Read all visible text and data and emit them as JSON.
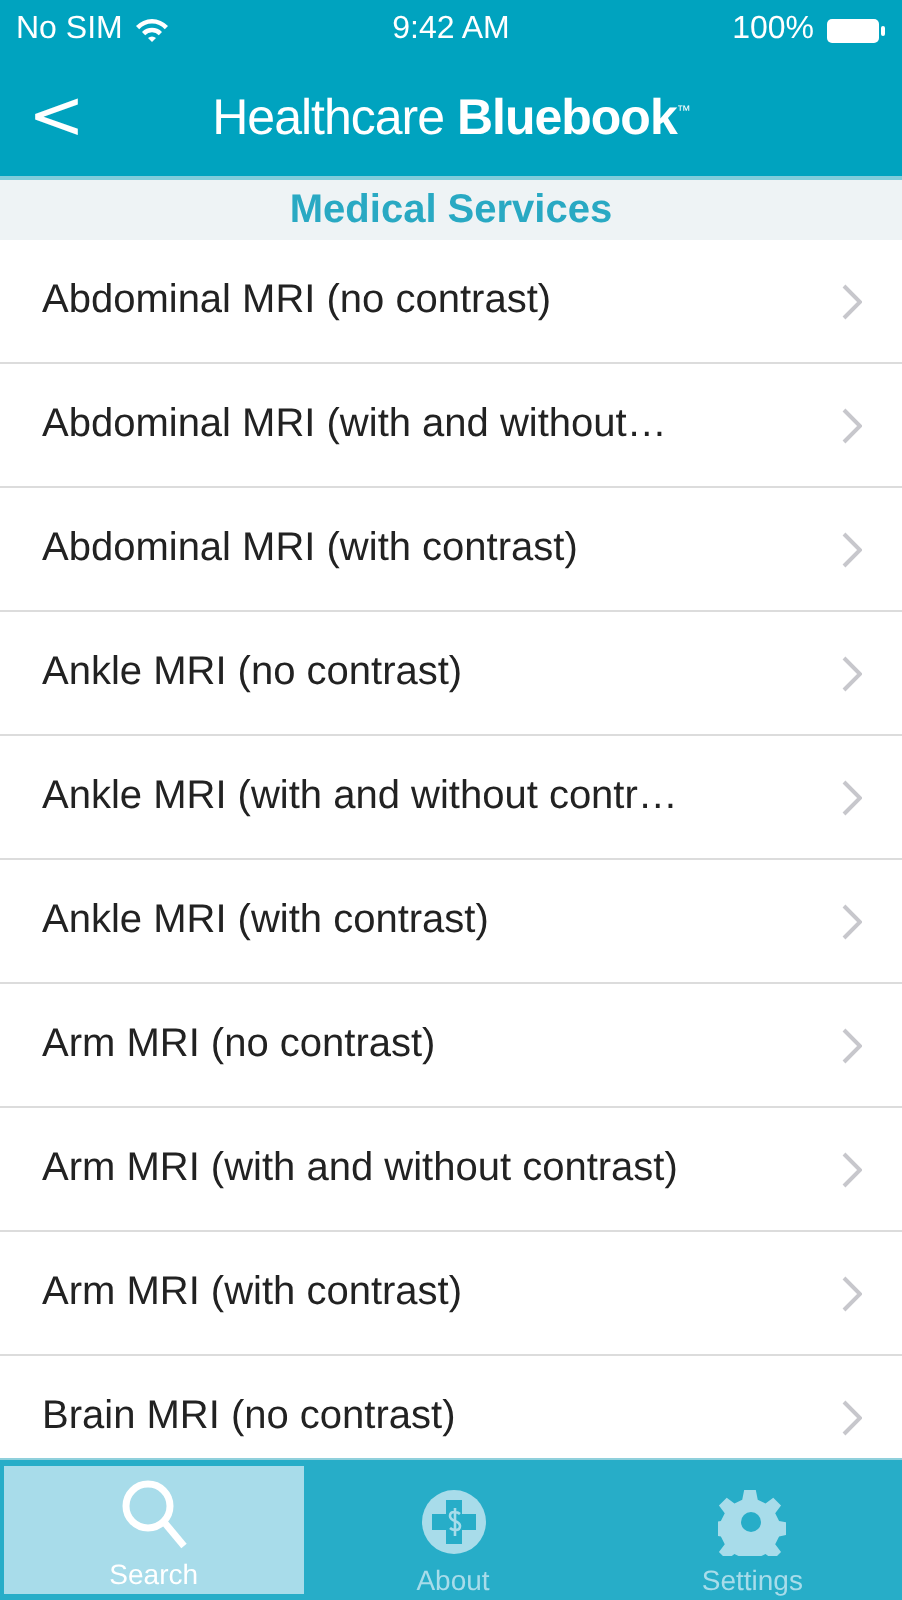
{
  "status_bar": {
    "carrier": "No SIM",
    "time": "9:42 AM",
    "battery": "100%"
  },
  "nav": {
    "back": "<",
    "title": "Healthcare **Bluebook**$^{™}$"
  },
  "section": {
    "title": "Medical Services"
  },
  "services": [
    {
      "label": "Abdominal MRI (no contrast)"
    },
    {
      "label": "Abdominal MRI (with and without…"
    },
    {
      "label": "Abdominal MRI (with contrast)"
    },
    {
      "label": "Ankle MRI (no contrast)"
    },
    {
      "label": "Ankle MRI (with and without contr…"
    },
    {
      "label": "Ankle MRI (with contrast)"
    },
    {
      "label": "Arm MRI (no contrast)"
    },
    {
      "label": "Arm MRI (with and without contrast)"
    },
    {
      "label": "Arm MRI (with contrast)"
    },
    {
      "label": "Brain MRI (no contrast)"
    }
  ],
  "tabs": [
    {
      "kind": "search",
      "label": "Search",
      "selected": true
    },
    {
      "kind": "about",
      "label": "About",
      "selected": false
    },
    {
      "kind": "settings",
      "label": "Settings",
      "selected": false
    }
  ]
}
